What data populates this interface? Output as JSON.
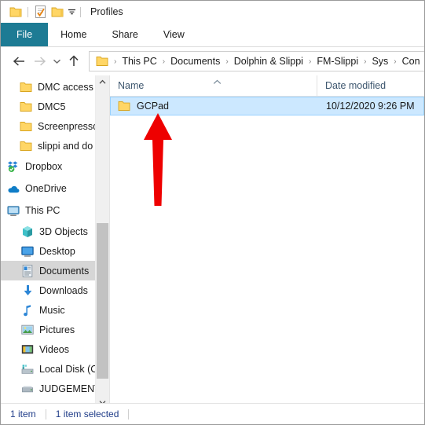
{
  "window": {
    "title": "Profiles",
    "quick_access": [
      {
        "name": "folder-icon",
        "label": "Folder"
      },
      {
        "name": "properties-icon",
        "label": "Properties"
      },
      {
        "name": "new-folder-icon",
        "label": "New folder"
      },
      {
        "name": "chevron-down-icon",
        "label": "Customize Quick Access Toolbar"
      }
    ]
  },
  "ribbon": {
    "tabs": [
      {
        "label": "File",
        "active": true
      },
      {
        "label": "Home",
        "active": false
      },
      {
        "label": "Share",
        "active": false
      },
      {
        "label": "View",
        "active": false
      }
    ]
  },
  "address": {
    "back_icon": "back-arrow-icon",
    "forward_icon": "forward-arrow-icon",
    "recent_icon": "recent-locations-chevron-icon",
    "up_icon": "up-arrow-icon",
    "folder_icon": "folder-icon",
    "crumbs": [
      "This PC",
      "Documents",
      "Dolphin & Slippi",
      "FM-Slippi",
      "Sys",
      "Con"
    ],
    "separator": "›"
  },
  "sidebar": {
    "items": [
      {
        "label": "DMC access",
        "icon": "folder-icon",
        "indent": 1,
        "selected": false
      },
      {
        "label": "DMC5",
        "icon": "folder-icon",
        "indent": 1,
        "selected": false
      },
      {
        "label": "Screenpresso",
        "icon": "folder-icon",
        "indent": 1,
        "selected": false
      },
      {
        "label": "slippi and do",
        "icon": "folder-icon",
        "indent": 1,
        "selected": false
      },
      {
        "label": "Dropbox",
        "icon": "dropbox-icon",
        "indent": 0,
        "selected": false
      },
      {
        "label": "OneDrive",
        "icon": "onedrive-cloud-icon",
        "indent": 0,
        "selected": false
      },
      {
        "label": "This PC",
        "icon": "this-pc-monitor-icon",
        "indent": 0,
        "selected": false
      },
      {
        "label": "3D Objects",
        "icon": "3d-objects-icon",
        "indent": 2,
        "selected": false
      },
      {
        "label": "Desktop",
        "icon": "desktop-icon",
        "indent": 2,
        "selected": false
      },
      {
        "label": "Documents",
        "icon": "documents-icon",
        "indent": 2,
        "selected": true
      },
      {
        "label": "Downloads",
        "icon": "downloads-arrow-icon",
        "indent": 2,
        "selected": false
      },
      {
        "label": "Music",
        "icon": "music-note-icon",
        "indent": 2,
        "selected": false
      },
      {
        "label": "Pictures",
        "icon": "pictures-icon",
        "indent": 2,
        "selected": false
      },
      {
        "label": "Videos",
        "icon": "videos-icon",
        "indent": 2,
        "selected": false
      },
      {
        "label": "Local Disk (C",
        "icon": "local-disk-icon",
        "indent": 2,
        "selected": false
      },
      {
        "label": "JUDGEMENT",
        "icon": "drive-icon",
        "indent": 2,
        "selected": false
      }
    ],
    "scrollbar": {
      "up_icon": "scroll-up-chevron-icon",
      "down_icon": "scroll-down-chevron-icon"
    }
  },
  "filelist": {
    "columns": [
      {
        "label": "Name",
        "sorted": true,
        "sort_icon": "sort-ascending-caret-icon"
      },
      {
        "label": "Date modified",
        "sorted": false,
        "sort_icon": ""
      }
    ],
    "rows": [
      {
        "name": "GCPad",
        "date_modified": "10/12/2020 9:26 PM",
        "icon": "folder-icon",
        "selected": true
      }
    ]
  },
  "statusbar": {
    "item_count": "1 item",
    "selection_count": "1 item selected"
  },
  "annotation": {
    "arrow": {
      "name": "red-arrow-annotation",
      "color": "#ee0000",
      "direction": "up",
      "points_to": "GCPad"
    }
  },
  "colors": {
    "file_tab": "#1d7b94",
    "selection_blue": "#cce8ff",
    "selection_border": "#99d1ff",
    "sidebar_selection": "#d6d6d6",
    "status_text": "#1f3c88",
    "folder_yellow": "#ffd666",
    "annotation_red": "#ee0000"
  }
}
